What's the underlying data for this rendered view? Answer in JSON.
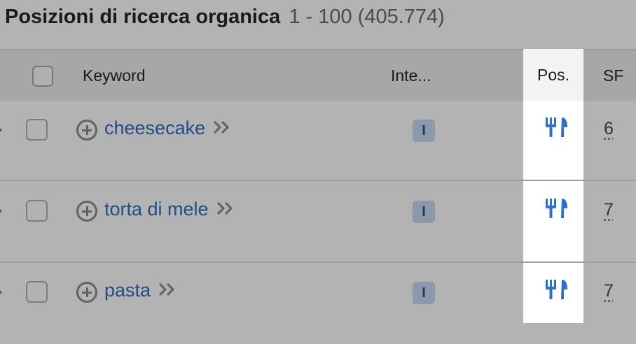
{
  "title": {
    "main": "Posizioni di ricerca organica",
    "range": "1 - 100 (405.774)"
  },
  "table": {
    "headers": {
      "keyword": "Keyword",
      "intent": "Inte...",
      "position": "Pos.",
      "sf": "SF"
    },
    "rows": [
      {
        "keyword": "cheesecake",
        "intent": "I",
        "position_icon": "restaurant-icon",
        "sf": "6"
      },
      {
        "keyword": "torta di mele",
        "intent": "I",
        "position_icon": "restaurant-icon",
        "sf": "7"
      },
      {
        "keyword": "pasta",
        "intent": "I",
        "position_icon": "restaurant-icon",
        "sf": "7"
      }
    ]
  },
  "colors": {
    "link": "#1f4e87",
    "icon": "#2b6fd1",
    "intent_badge": "#8b99ab"
  }
}
